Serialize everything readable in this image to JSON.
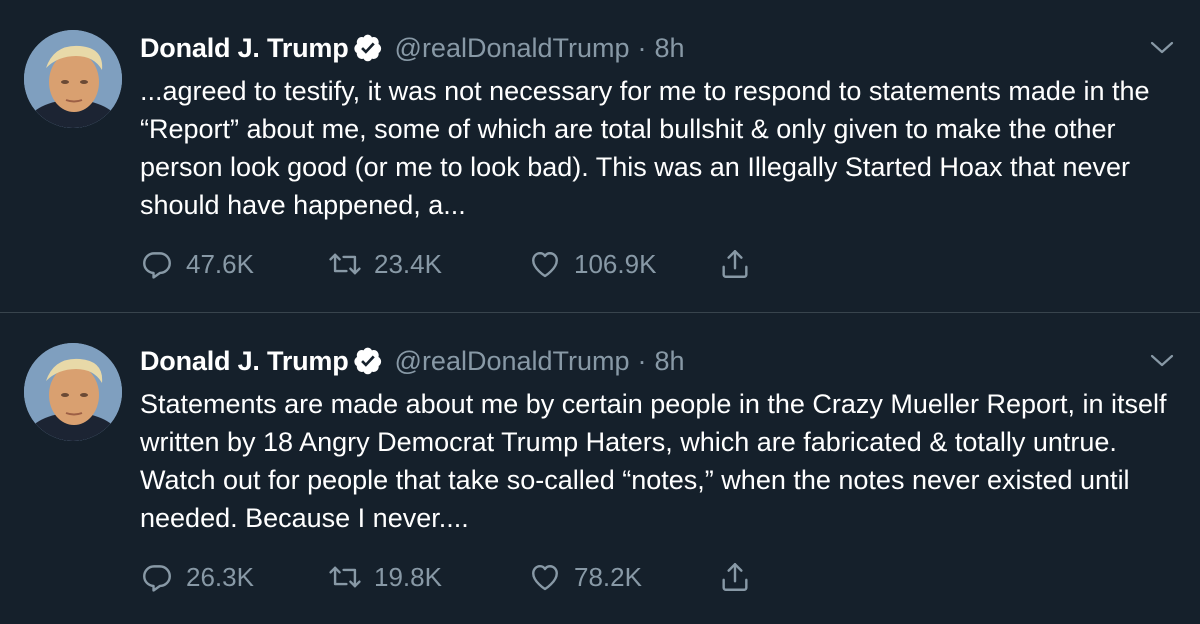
{
  "tweets": [
    {
      "name": "Donald J. Trump",
      "handle": "@realDonaldTrump",
      "separator": "·",
      "time": "8h",
      "text": "...agreed to testify, it was not necessary for me to respond to statements made in the “Report” about me, some of which are total bullshit & only given to make the other person look good (or me to look bad). This was an Illegally Started Hoax that never should have happened, a...",
      "replies": "47.6K",
      "retweets": "23.4K",
      "likes": "106.9K"
    },
    {
      "name": "Donald J. Trump",
      "handle": "@realDonaldTrump",
      "separator": "·",
      "time": "8h",
      "text": "Statements are made about me by certain people in the Crazy Mueller Report, in itself written by 18 Angry Democrat Trump Haters, which are fabricated & totally untrue. Watch out for people that take so-called “notes,” when the notes never existed until needed. Because I never....",
      "replies": "26.3K",
      "retweets": "19.8K",
      "likes": "78.2K"
    }
  ],
  "colors": {
    "background": "#15202b",
    "text": "#ffffff",
    "secondary": "#8899a6",
    "divider": "#38444d"
  },
  "icons": {
    "verified": "verified-badge-icon",
    "caret": "chevron-down-icon",
    "reply": "reply-bubble-icon",
    "retweet": "retweet-icon",
    "like": "heart-icon",
    "share": "share-upload-icon"
  }
}
